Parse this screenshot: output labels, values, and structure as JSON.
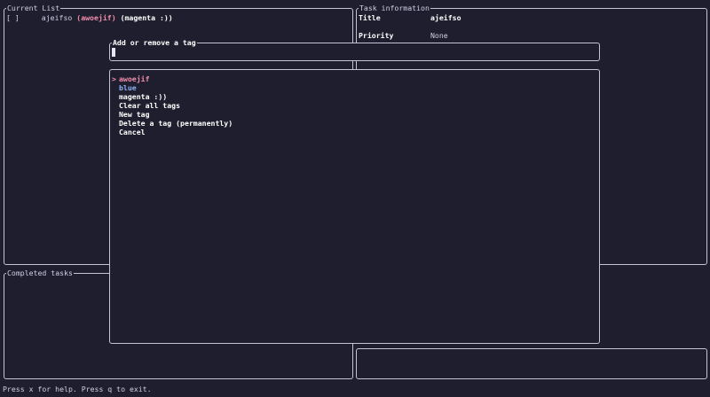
{
  "current_list": {
    "title": "Current List",
    "tasks": [
      {
        "checkbox": "[ ]",
        "name": "ajeifso",
        "tags_open": "(",
        "tag_primary": "awoejif",
        "tags_close": ")",
        "tag_secondary": "(magenta :))"
      }
    ]
  },
  "task_info": {
    "title": "Task information",
    "fields": [
      {
        "label": "Title",
        "value": "ajeifso"
      },
      {
        "label": "Priority",
        "value": "None"
      }
    ]
  },
  "completed": {
    "title": "Completed tasks"
  },
  "tag_dialog": {
    "title": "Add or remove a tag",
    "input_value": "",
    "pointer": ">",
    "options": [
      {
        "label": "awoejif",
        "color": "#f28fad"
      },
      {
        "label": "blue",
        "color": "#8cb4f5"
      },
      {
        "label": "magenta :))",
        "color": "#ffffff"
      },
      {
        "label": "Clear all tags",
        "color": "#ffffff"
      },
      {
        "label": "New tag",
        "color": "#ffffff"
      },
      {
        "label": "Delete a tag (permanently)",
        "color": "#ffffff"
      },
      {
        "label": "Cancel",
        "color": "#ffffff"
      }
    ]
  },
  "status_bar": {
    "text": "Press x for help. Press q to exit."
  },
  "colors": {
    "background": "#1f1e2e",
    "border": "#c3c4d6",
    "accent_pink": "#f28fad",
    "accent_blue": "#8cb4f5",
    "text": "#cfd0e4"
  }
}
